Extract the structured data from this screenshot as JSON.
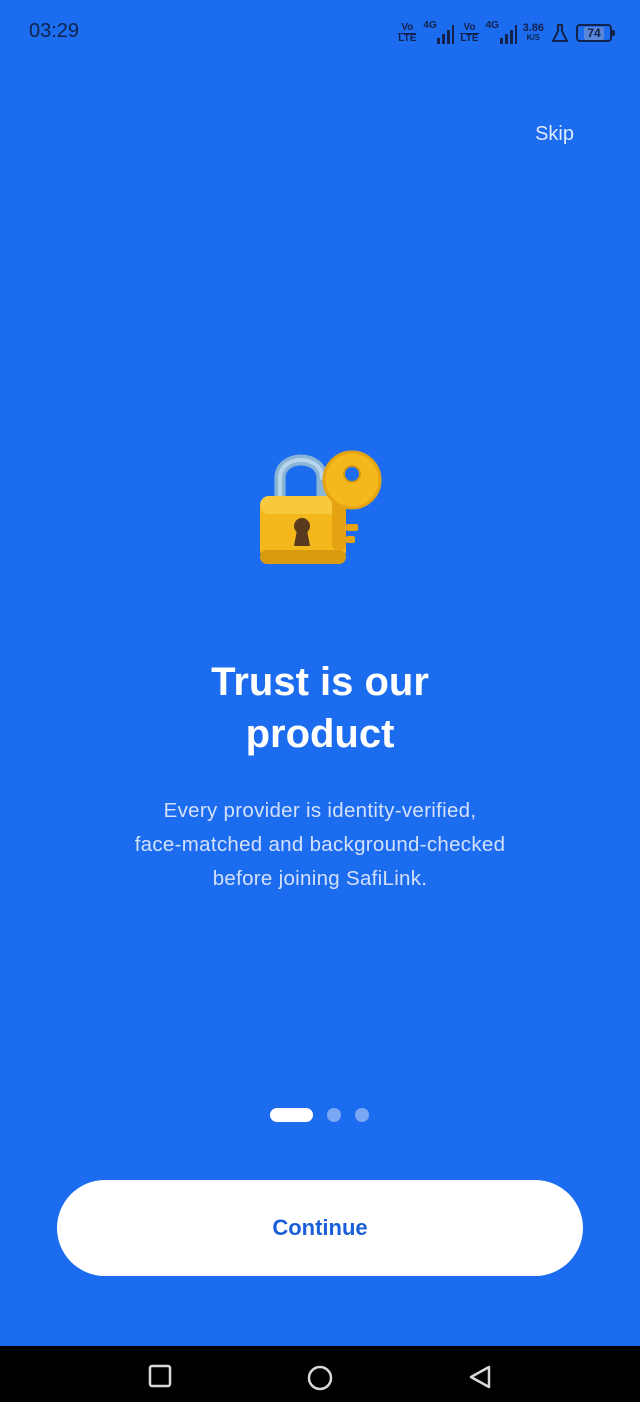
{
  "status_bar": {
    "time": "03:29",
    "sim1": {
      "top": "Vo",
      "bottom": "LTE",
      "network": "4G"
    },
    "sim2": {
      "top": "Vo",
      "bottom": "LTE",
      "network": "4G"
    },
    "speed_value": "3.86",
    "speed_unit": "K/S",
    "battery": "74",
    "icons": [
      "volte-icon",
      "signal-icon",
      "volte-icon",
      "signal-icon",
      "lab-flask-icon",
      "battery-icon"
    ]
  },
  "onboarding": {
    "skip_label": "Skip",
    "illustration": "lock-with-key-icon",
    "title_line1": "Trust is our",
    "title_line2": "product",
    "desc_line1": "Every provider is identity-verified,",
    "desc_line2": "face-matched and background-checked",
    "desc_line3": "before joining SafiLink.",
    "pagination": {
      "current": 1,
      "total": 3
    },
    "continue_label": "Continue"
  },
  "nav_bar": {
    "icons": [
      "recents-square-icon",
      "home-circle-icon",
      "back-triangle-icon"
    ]
  },
  "colors": {
    "background": "#1c6cf0",
    "button_bg": "#ffffff",
    "button_text": "#1a5fd8",
    "dot_inactive": "#7ba6f3"
  }
}
